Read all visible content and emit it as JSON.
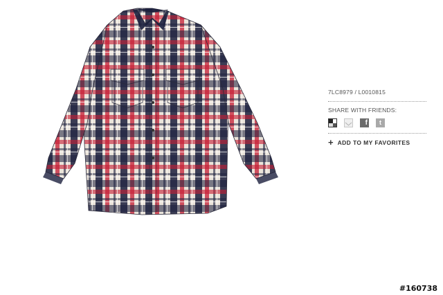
{
  "product": {
    "image_icon": "plaid-flannel-shirt",
    "sku": "7LC8979 / L0010815"
  },
  "share": {
    "label": "SHARE WITH FRIENDS:",
    "icons": [
      "delicious-icon",
      "email-icon",
      "facebook-icon",
      "twitter-icon"
    ],
    "facebook_glyph": "f",
    "twitter_glyph": "t"
  },
  "favorites": {
    "plus": "+",
    "label": "ADD TO MY FAVORITES"
  },
  "image_id": "#160738",
  "colors": {
    "plaid_red": "#c61d34",
    "plaid_navy": "#1b1f3d",
    "plaid_cream": "#efe9df"
  }
}
